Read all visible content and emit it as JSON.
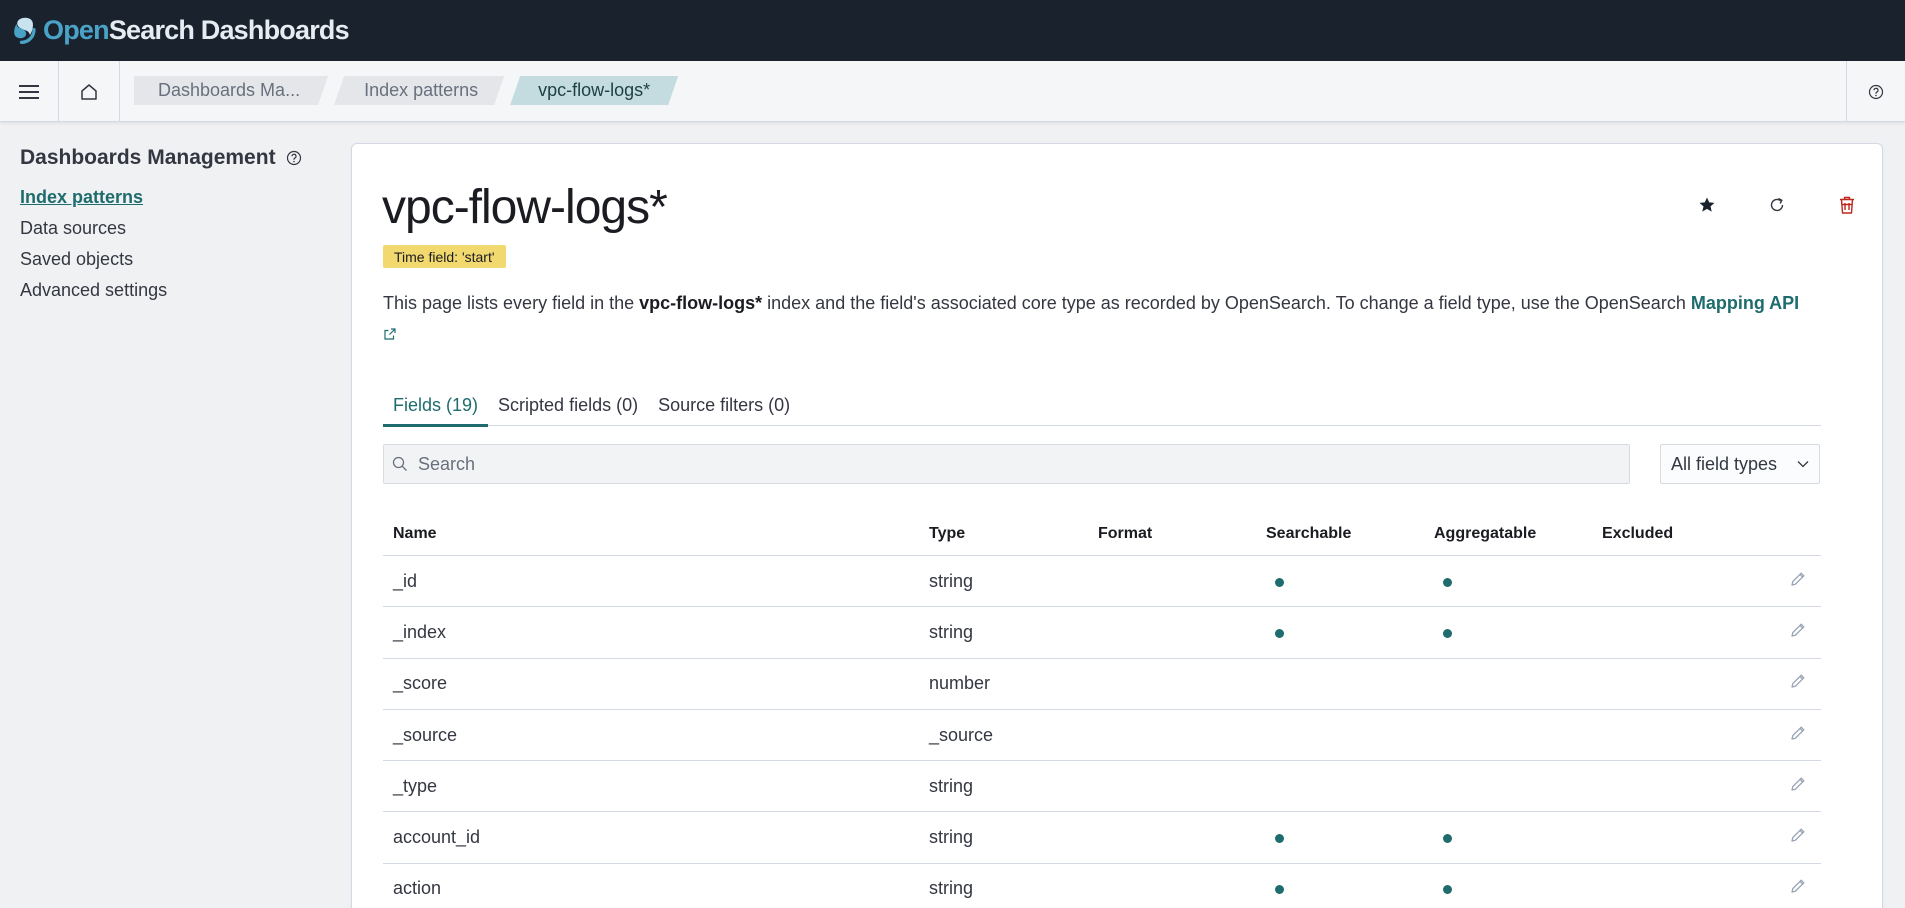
{
  "app": {
    "logo_open": "Open",
    "logo_rest": "Search Dashboards"
  },
  "breadcrumbs": [
    "Dashboards Ma...",
    "Index patterns",
    "vpc-flow-logs*"
  ],
  "sidebar": {
    "title": "Dashboards Management",
    "items": [
      {
        "label": "Index patterns",
        "active": true
      },
      {
        "label": "Data sources",
        "active": false
      },
      {
        "label": "Saved objects",
        "active": false
      },
      {
        "label": "Advanced settings",
        "active": false
      }
    ]
  },
  "main": {
    "title": "vpc-flow-logs*",
    "time_field_badge": "Time field: 'start'",
    "desc_pre": "This page lists every field in the ",
    "desc_bold": "vpc-flow-logs*",
    "desc_post": " index and the field's associated core type as recorded by OpenSearch. To change a field type, use the OpenSearch ",
    "desc_link": "Mapping API",
    "tabs": [
      {
        "label": "Fields (19)",
        "active": true
      },
      {
        "label": "Scripted fields (0)",
        "active": false
      },
      {
        "label": "Source filters (0)",
        "active": false
      }
    ],
    "search_placeholder": "Search",
    "type_filter": "All field types",
    "columns": {
      "name": "Name",
      "type": "Type",
      "format": "Format",
      "searchable": "Searchable",
      "aggregatable": "Aggregatable",
      "excluded": "Excluded"
    },
    "rows": [
      {
        "name": "_id",
        "type": "string",
        "searchable": true,
        "aggregatable": true
      },
      {
        "name": "_index",
        "type": "string",
        "searchable": true,
        "aggregatable": true
      },
      {
        "name": "_score",
        "type": "number",
        "searchable": false,
        "aggregatable": false
      },
      {
        "name": "_source",
        "type": "_source",
        "searchable": false,
        "aggregatable": false
      },
      {
        "name": "_type",
        "type": "string",
        "searchable": false,
        "aggregatable": false
      },
      {
        "name": "account_id",
        "type": "string",
        "searchable": true,
        "aggregatable": true
      },
      {
        "name": "action",
        "type": "string",
        "searchable": true,
        "aggregatable": true
      }
    ]
  },
  "colors": {
    "header_bg": "#1a232d",
    "accent": "#1e6c6d",
    "badge_bg": "#f1d86f",
    "delete": "#bd271e"
  }
}
